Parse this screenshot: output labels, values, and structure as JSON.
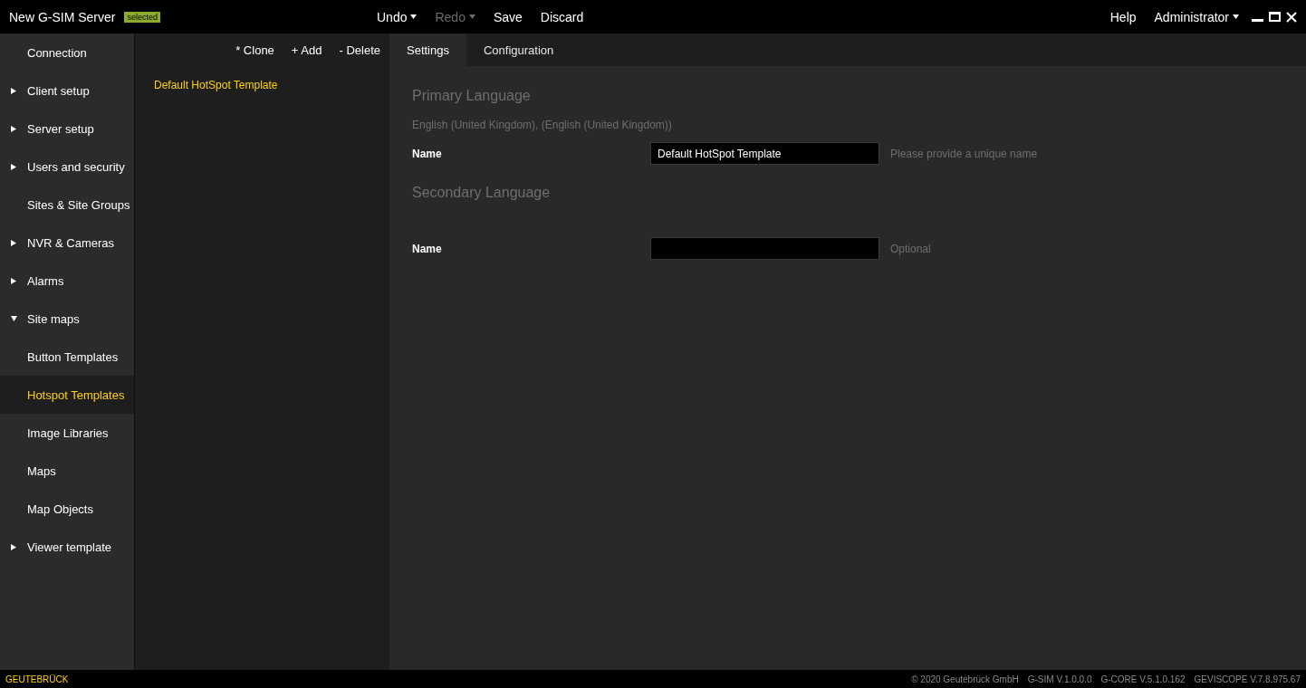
{
  "window": {
    "title": "New G-SIM Server",
    "badge": "selected"
  },
  "toolbar": [
    {
      "label": "Undo",
      "disabled": false,
      "menu": true
    },
    {
      "label": "Redo",
      "disabled": true,
      "menu": true
    },
    {
      "label": "Save",
      "disabled": false,
      "menu": false
    },
    {
      "label": "Discard",
      "disabled": false,
      "menu": false
    }
  ],
  "help": "Help",
  "user": "Administrator",
  "sidebar": {
    "items": [
      {
        "label": "Connection",
        "kind": "leaf",
        "selected": false
      },
      {
        "label": "Client setup",
        "kind": "group",
        "expanded": false,
        "selected": false
      },
      {
        "label": "Server setup",
        "kind": "group",
        "expanded": false,
        "selected": false
      },
      {
        "label": "Users and security",
        "kind": "group",
        "expanded": false,
        "selected": false
      },
      {
        "label": "Sites & Site Groups",
        "kind": "leaf",
        "selected": false
      },
      {
        "label": "NVR & Cameras",
        "kind": "group",
        "expanded": false,
        "selected": false
      },
      {
        "label": "Alarms",
        "kind": "group",
        "expanded": false,
        "selected": false
      },
      {
        "label": "Site maps",
        "kind": "group",
        "expanded": true,
        "selected": false
      },
      {
        "label": "Button Templates",
        "kind": "leaf",
        "selected": false
      },
      {
        "label": "Hotspot Templates",
        "kind": "leaf",
        "selected": true
      },
      {
        "label": "Image Libraries",
        "kind": "leaf",
        "selected": false
      },
      {
        "label": "Maps",
        "kind": "leaf",
        "selected": false
      },
      {
        "label": "Map Objects",
        "kind": "leaf",
        "selected": false
      },
      {
        "label": "Viewer template",
        "kind": "group",
        "expanded": false,
        "selected": false
      }
    ]
  },
  "list": {
    "actions": [
      "* Clone",
      "+ Add",
      "- Delete"
    ],
    "items": [
      {
        "label": "Default HotSpot Template",
        "selected": true
      }
    ]
  },
  "tabs": [
    {
      "label": "Settings",
      "selected": true
    },
    {
      "label": "Configuration",
      "selected": false
    }
  ],
  "sections": [
    {
      "heading": "Primary Language",
      "subtitle": "English (United Kingdom), (English (United Kingdom))",
      "field": {
        "label": "Name",
        "value": "Default HotSpot Template",
        "hint": "Please provide a unique name"
      }
    },
    {
      "heading": "Secondary Language",
      "field": {
        "label": "Name",
        "hint": "Optional"
      }
    }
  ],
  "status_bar": {
    "brand": "GEUTEBRÜCK",
    "items": [
      "© 2020 Geutebrück GmbH",
      "G-SIM V.1.0.0.0",
      "G-CORE V.5.1.0.162",
      "GEVISCOPE V.7.8.975.67"
    ]
  }
}
